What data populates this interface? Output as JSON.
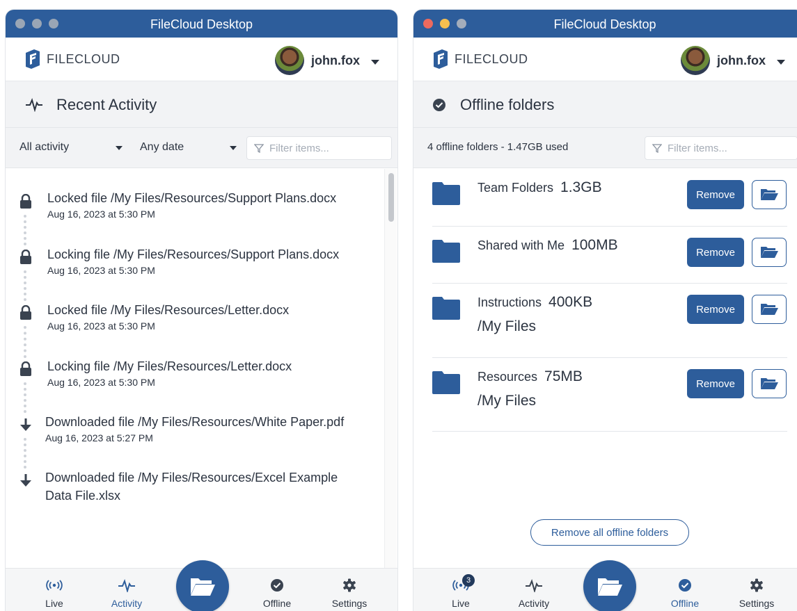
{
  "left_window": {
    "title": "FileCloud Desktop",
    "logo_text": "FILECLOUD",
    "username": "john.fox",
    "section_title": "Recent Activity",
    "filters": {
      "activity_type": "All activity",
      "date_range": "Any date",
      "search_placeholder": "Filter items..."
    },
    "activities": [
      {
        "icon": "lock-icon",
        "title": "Locked file /My Files/Resources/Support Plans.docx",
        "date": "Aug 16, 2023 at 5:30 PM"
      },
      {
        "icon": "lock-icon",
        "title": "Locking file /My Files/Resources/Support Plans.docx",
        "date": "Aug 16, 2023 at 5:30 PM"
      },
      {
        "icon": "lock-icon",
        "title": "Locked file /My Files/Resources/Letter.docx",
        "date": "Aug 16, 2023 at 5:30 PM"
      },
      {
        "icon": "lock-icon",
        "title": "Locking file /My Files/Resources/Letter.docx",
        "date": "Aug 16, 2023 at 5:30 PM"
      },
      {
        "icon": "download-icon",
        "title": "Downloaded file /My Files/Resources/White Paper.pdf",
        "date": "Aug 16, 2023 at 5:27 PM"
      },
      {
        "icon": "download-icon",
        "title_line1": "Downloaded file /My Files/Resources/Excel Example",
        "title_line2": "Data File.xlsx"
      }
    ],
    "nav": {
      "live": "Live",
      "activity": "Activity",
      "offline": "Offline",
      "settings": "Settings",
      "active": "activity"
    }
  },
  "right_window": {
    "title": "FileCloud Desktop",
    "logo_text": "FILECLOUD",
    "username": "john.fox",
    "section_title": "Offline folders",
    "storage_summary": "4 offline folders - 1.47GB used",
    "search_placeholder": "Filter items...",
    "folders": [
      {
        "name": "Team Folders",
        "size": "1.3GB",
        "path": ""
      },
      {
        "name": "Shared with Me",
        "size": "100MB",
        "path": ""
      },
      {
        "name": "Instructions",
        "size": "400KB",
        "path": "/My Files"
      },
      {
        "name": "Resources",
        "size": "75MB",
        "path": "/My Files"
      }
    ],
    "remove_label": "Remove",
    "remove_all_label": "Remove all offline folders",
    "nav": {
      "live": "Live",
      "live_badge": "3",
      "activity": "Activity",
      "offline": "Offline",
      "settings": "Settings",
      "active": "offline"
    }
  },
  "colors": {
    "brand": "#2d5d9b",
    "titlebar": "#2d5d9b",
    "section_bg": "#f2f3f5"
  }
}
